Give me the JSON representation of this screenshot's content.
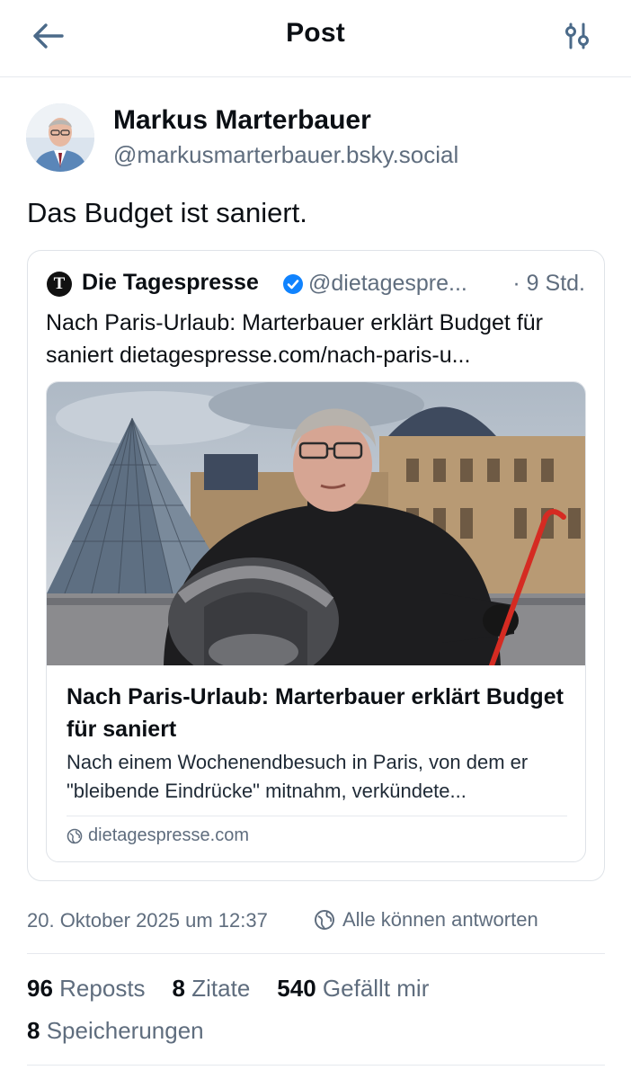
{
  "header": {
    "title": "Post",
    "back_icon": "arrow-left-icon",
    "filter_icon": "sliders-icon"
  },
  "post": {
    "author_name": "Markus Marterbauer",
    "author_handle": "@markusmarterbauer.bsky.social",
    "text": "Das Budget ist saniert.",
    "timestamp": "20. Oktober 2025 um 12:37",
    "reply_setting": "Alle können antworten"
  },
  "quote": {
    "logo_letter": "T",
    "author_name": "Die Tagespresse",
    "verified": true,
    "author_handle": "@dietagespre...",
    "time": "· 9 Std.",
    "text": "Nach Paris-Urlaub: Marterbauer erklärt Budget für saniert dietagespresse.com/nach-paris-u...",
    "card": {
      "title": "Nach Paris-Urlaub: Marterbauer erklärt Budget für saniert",
      "description": "Nach einem Wochenendbesuch in Paris, von dem er \"bleibende Eindrücke\" mitnahm, verkündete...",
      "domain": "dietagespresse.com"
    }
  },
  "stats": {
    "reposts_count": "96",
    "reposts_label": "Reposts",
    "quotes_count": "8",
    "quotes_label": "Zitate",
    "likes_count": "540",
    "likes_label": "Gefällt mir",
    "saves_count": "8",
    "saves_label": "Speicherungen"
  },
  "colors": {
    "accent": "#1083fe",
    "muted": "#5f6d7e",
    "divider": "#e6e9ee"
  }
}
